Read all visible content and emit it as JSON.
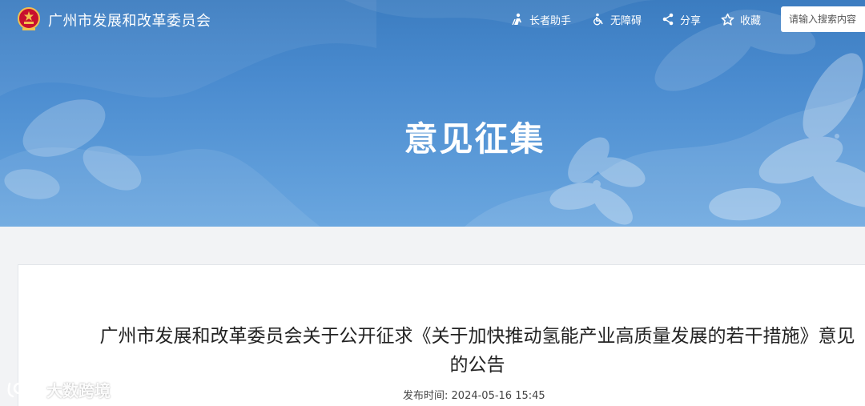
{
  "header": {
    "site_title": "广州市发展和改革委员会",
    "tools": {
      "elder": "长者助手",
      "accessibility": "无障碍",
      "share": "分享",
      "favorite": "收藏"
    },
    "search_placeholder": "请输入搜索内容"
  },
  "banner": {
    "title": "意见征集"
  },
  "article": {
    "title": "广州市发展和改革委员会关于公开征求《关于加快推动氢能产业高质量发展的若干措施》意见的公告",
    "publish_label": "发布时间:",
    "publish_time": "2024-05-16 15:45"
  },
  "watermark": {
    "text": "大数跨境"
  },
  "colors": {
    "banner_top": "#3b7cc0",
    "banner_bottom": "#6aa6df",
    "page_bg": "#f2f3f5"
  }
}
